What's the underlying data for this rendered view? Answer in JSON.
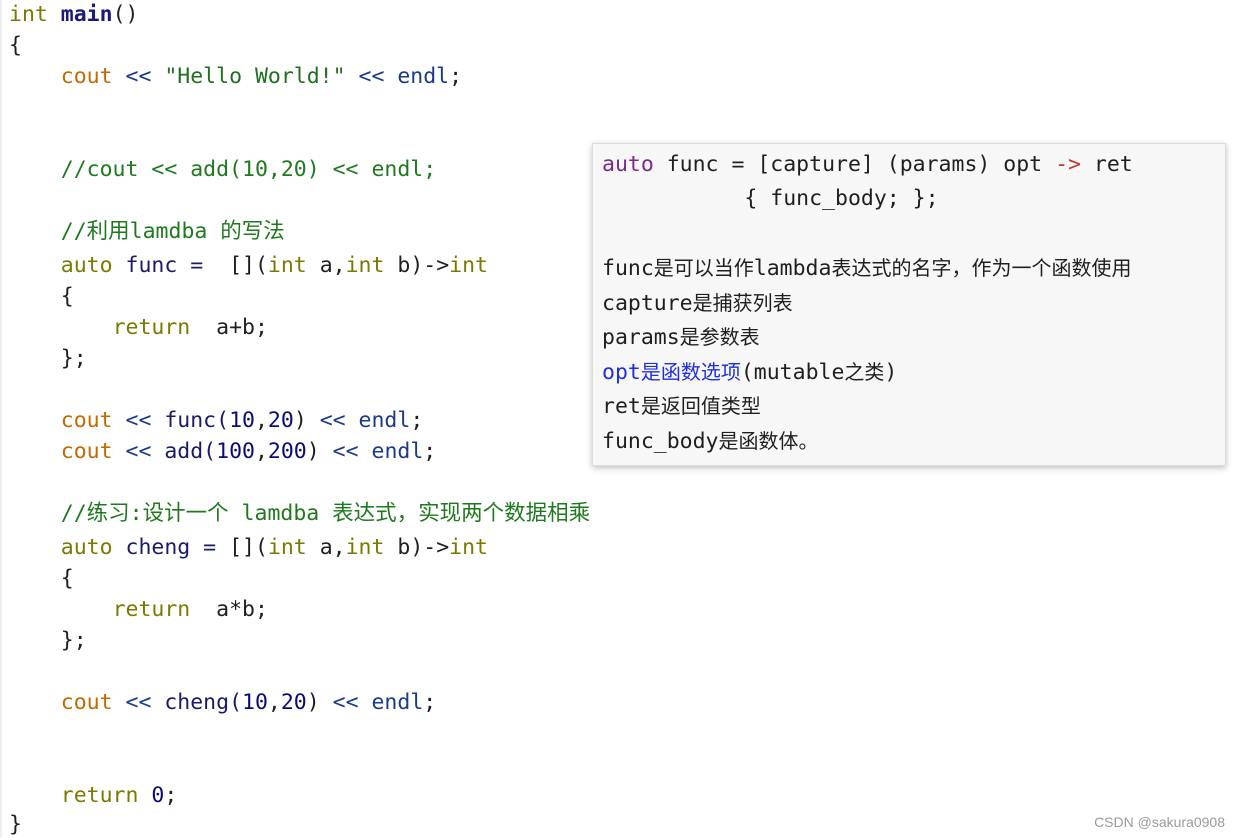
{
  "code": {
    "l1_int": "int",
    "l1_main": "main",
    "l1_parens": "()",
    "l2_brace": "{",
    "l3_cout": "cout",
    "l3_op1": " << ",
    "l3_str": "\"Hello World!\"",
    "l3_op2": " << ",
    "l3_endl": "endl",
    "l3_semi": ";",
    "l6_comment": "//cout << add(10,20) << endl;",
    "l8_comment": "//利用lamdba 的写法",
    "l9_auto": "auto",
    "l9_func": " func = ",
    "l9_rest1": " [](",
    "l9_int1": "int",
    "l9_a": " a,",
    "l9_int2": "int",
    "l9_b": " b)->",
    "l9_int3": "int",
    "l10_brace": "{",
    "l11_return": "return",
    "l11_expr": "  a+b;",
    "l12_close": "};",
    "l14_cout": "cout",
    "l14_op1": " << ",
    "l14_call": "func(",
    "l14_n1": "10",
    "l14_comma": ",",
    "l14_n2": "20",
    "l14_close": ")",
    "l14_op2": " << ",
    "l14_endl": "endl",
    "l14_semi": ";",
    "l15_cout": "cout",
    "l15_op1": " << ",
    "l15_call": "add(",
    "l15_n1": "100",
    "l15_comma": ",",
    "l15_n2": "200",
    "l15_close": ")",
    "l15_op2": " << ",
    "l15_endl": "endl",
    "l15_semi": ";",
    "l17_comment": "//练习:设计一个 lamdba 表达式，实现两个数据相乘",
    "l18_auto": "auto",
    "l18_name": " cheng = ",
    "l18_rest1": "[](",
    "l18_int1": "int",
    "l18_a": " a,",
    "l18_int2": "int",
    "l18_b": " b)->",
    "l18_int3": "int",
    "l19_brace": "{",
    "l20_return": "return",
    "l20_expr": "  a*b;",
    "l21_close": "};",
    "l23_cout": "cout",
    "l23_op1": " << ",
    "l23_call": "cheng(",
    "l23_n1": "10",
    "l23_comma": ",",
    "l23_n2": "20",
    "l23_close": ")",
    "l23_op2": " << ",
    "l23_endl": "endl",
    "l23_semi": ";",
    "l26_return": "return",
    "l26_zero": " 0",
    "l26_semi": ";",
    "l27_brace": "}"
  },
  "popup": {
    "p1_auto": "auto",
    "p1_func": " func = ",
    "p1_rest": "[capture] (params) opt ",
    "p1_arrow": "->",
    "p1_ret": " ret",
    "p2": "           { func_body; };",
    "p4_mono": "func",
    "p4_cjk1": "是可以当作",
    "p4_mono2": "lambda",
    "p4_cjk2": "表达式的名字，作为一个函数使用",
    "p5_mono": "capture",
    "p5_cjk": "是捕获列表",
    "p6_mono": "params",
    "p6_cjk": "是参数表",
    "p7_mono": "opt",
    "p7_cjk": "是函数选项",
    "p7_mono2": "(mutable",
    "p7_cjk2": "之类",
    "p7_mono3": ")",
    "p8_mono": "ret",
    "p8_cjk": "是返回值类型",
    "p9_mono": "func_body",
    "p9_cjk": "是函数体。"
  },
  "watermark": "CSDN @sakura0908"
}
